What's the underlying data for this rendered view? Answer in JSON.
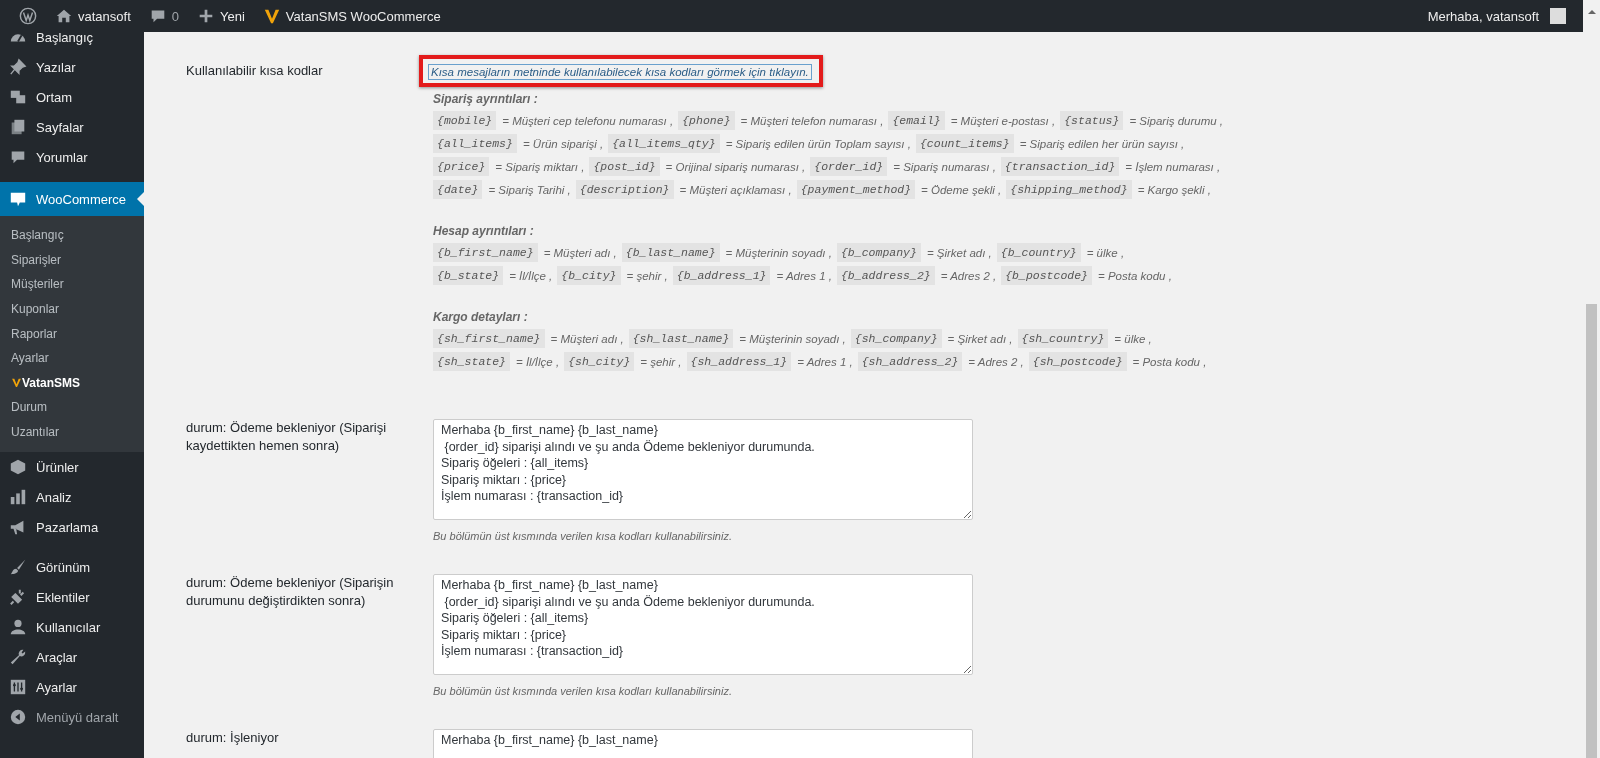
{
  "admin_bar": {
    "items": [
      {
        "label": "vatansoft"
      },
      {
        "label": "0"
      },
      {
        "label": "Yeni"
      },
      {
        "label": "VatanSMS WooCommerce"
      }
    ],
    "greeting": "Merhaba, vatansoft"
  },
  "sidebar": {
    "groups": [
      {
        "items": [
          {
            "label": "Başlangıç",
            "selected": false
          },
          {
            "label": "Yazılar",
            "selected": false
          },
          {
            "label": "Ortam",
            "selected": false
          },
          {
            "label": "Sayfalar",
            "selected": false
          },
          {
            "label": "Yorumlar",
            "selected": false
          }
        ]
      },
      {
        "items": [
          {
            "label": "WooCommerce",
            "selected": true,
            "children": [
              {
                "label": "Başlangıç",
                "current": false,
                "kind": "link"
              },
              {
                "label": "Siparişler",
                "current": false,
                "kind": "link"
              },
              {
                "label": "Müşteriler",
                "current": false,
                "kind": "link"
              },
              {
                "label": "Kuponlar",
                "current": false,
                "kind": "link"
              },
              {
                "label": "Raporlar",
                "current": false,
                "kind": "link"
              },
              {
                "label": "Ayarlar",
                "current": false,
                "kind": "link"
              },
              {
                "label": "VatanSMS",
                "current": true,
                "kind": "plugin"
              },
              {
                "label": "Durum",
                "current": false,
                "kind": "link"
              },
              {
                "label": "Uzantılar",
                "current": false,
                "kind": "link"
              }
            ]
          },
          {
            "label": "Ürünler",
            "selected": false
          },
          {
            "label": "Analiz",
            "selected": false
          },
          {
            "label": "Pazarlama",
            "selected": false
          }
        ]
      },
      {
        "items": [
          {
            "label": "Görünüm",
            "selected": false
          },
          {
            "label": "Eklentiler",
            "selected": false
          },
          {
            "label": "Kullanıcılar",
            "selected": false
          },
          {
            "label": "Araçlar",
            "selected": false
          },
          {
            "label": "Ayarlar",
            "selected": false
          },
          {
            "label": "Menüyü daralt",
            "selected": false
          }
        ]
      }
    ]
  },
  "shortcodes": {
    "label": "Kullanılabilir kısa kodlar",
    "link": "Kısa mesajların metninde kullanılabilecek kısa kodları görmek için tıklayın.",
    "highlighted": true,
    "sections": [
      {
        "title": "Sipariş ayrıntıları :",
        "lines": [
          [
            {
              "code": "{mobile}",
              "desc": "= Müşteri cep telefonu numarası ,"
            },
            {
              "code": "{phone}",
              "desc": "= Müşteri telefon numarası ,"
            },
            {
              "code": "{email}",
              "desc": "= Müşteri e-postası ,"
            },
            {
              "code": "{status}",
              "desc": "= Sipariş durumu ,"
            }
          ],
          [
            {
              "code": "{all_items}",
              "desc": "= Ürün siparişi ,"
            },
            {
              "code": "{all_items_qty}",
              "desc": "= Sipariş edilen ürün Toplam sayısı ,"
            },
            {
              "code": "{count_items}",
              "desc": "= Sipariş edilen her ürün sayısı ,"
            }
          ],
          [
            {
              "code": "{price}",
              "desc": "= Sipariş miktarı ,"
            },
            {
              "code": "{post_id}",
              "desc": "= Orijinal sipariş numarası ,"
            },
            {
              "code": "{order_id}",
              "desc": "= Sipariş numarası ,"
            },
            {
              "code": "{transaction_id}",
              "desc": "= İşlem numarası ,"
            }
          ],
          [
            {
              "code": "{date}",
              "desc": "= Sipariş Tarihi ,"
            },
            {
              "code": "{description}",
              "desc": "= Müşteri açıklaması ,"
            },
            {
              "code": "{payment_method}",
              "desc": "= Ödeme şekli ,"
            },
            {
              "code": "{shipping_method}",
              "desc": "= Kargo şekli ,"
            }
          ]
        ]
      },
      {
        "title": "Hesap ayrıntıları :",
        "lines": [
          [
            {
              "code": "{b_first_name}",
              "desc": "= Müşteri adı ,"
            },
            {
              "code": "{b_last_name}",
              "desc": "= Müşterinin soyadı ,"
            },
            {
              "code": "{b_company}",
              "desc": "= Şirket adı ,"
            },
            {
              "code": "{b_country}",
              "desc": "= ülke ,"
            }
          ],
          [
            {
              "code": "{b_state}",
              "desc": "= İl/İlçe ,"
            },
            {
              "code": "{b_city}",
              "desc": "= şehir ,"
            },
            {
              "code": "{b_address_1}",
              "desc": "= Adres 1 ,"
            },
            {
              "code": "{b_address_2}",
              "desc": "= Adres 2 ,"
            },
            {
              "code": "{b_postcode}",
              "desc": "= Posta kodu ,"
            }
          ]
        ]
      },
      {
        "title": "Kargo detayları :",
        "lines": [
          [
            {
              "code": "{sh_first_name}",
              "desc": "= Müşteri adı ,"
            },
            {
              "code": "{sh_last_name}",
              "desc": "= Müşterinin soyadı ,"
            },
            {
              "code": "{sh_company}",
              "desc": "= Şirket adı ,"
            },
            {
              "code": "{sh_country}",
              "desc": "= ülke ,"
            }
          ],
          [
            {
              "code": "{sh_state}",
              "desc": "= İl/İlçe ,"
            },
            {
              "code": "{sh_city}",
              "desc": "= şehir ,"
            },
            {
              "code": "{sh_address_1}",
              "desc": "= Adres 1 ,"
            },
            {
              "code": "{sh_address_2}",
              "desc": "= Adres 2 ,"
            },
            {
              "code": "{sh_postcode}",
              "desc": "= Posta kodu ,"
            }
          ]
        ]
      }
    ]
  },
  "templates": [
    {
      "label": "durum: Ödeme bekleniyor (Siparişi kaydettikten hemen sonra)",
      "value": "Merhaba {b_first_name} {b_last_name}\n {order_id} siparişi alındı ve şu anda Ödeme bekleniyor durumunda.\nSipariş öğeleri : {all_items}\nSipariş miktarı : {price}\nİşlem numarası : {transaction_id}",
      "hint": "Bu bölümün üst kısmında verilen kısa kodları kullanabilirsiniz."
    },
    {
      "label": "durum: Ödeme bekleniyor (Siparişin durumunu değiştirdikten sonra)",
      "value": "Merhaba {b_first_name} {b_last_name}\n {order_id} siparişi alındı ve şu anda Ödeme bekleniyor durumunda.\nSipariş öğeleri : {all_items}\nSipariş miktarı : {price}\nİşlem numarası : {transaction_id}",
      "hint": "Bu bölümün üst kısmında verilen kısa kodları kullanabilirsiniz."
    },
    {
      "label": "durum: İşleniyor",
      "value": "Merhaba {b_first_name} {b_last_name}"
    }
  ]
}
